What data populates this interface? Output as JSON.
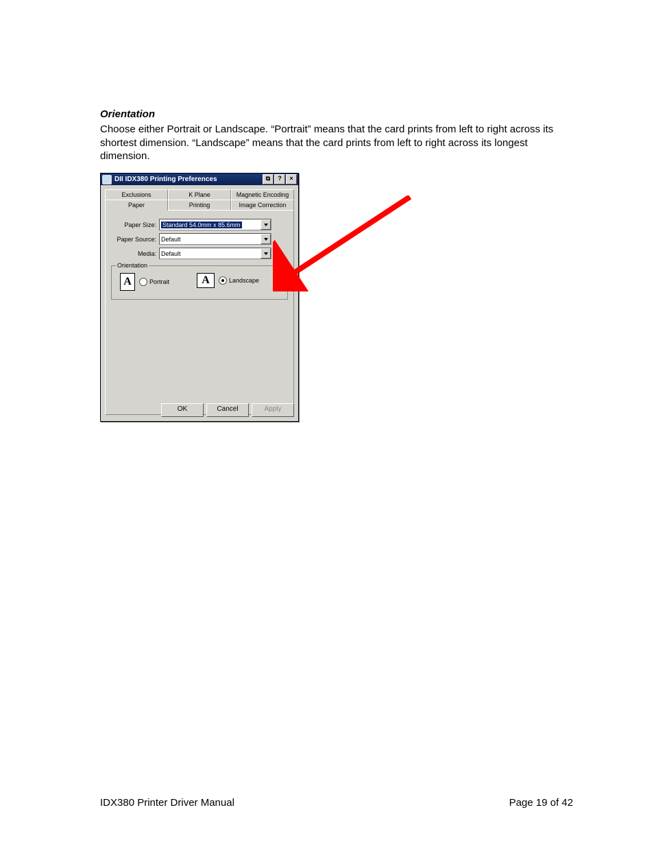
{
  "doc": {
    "section_title": "Orientation",
    "body_text": "Choose either Portrait or Landscape. “Portrait” means that the card prints from left to right across its shortest dimension. “Landscape” means that the card prints from left to right across its longest dimension.",
    "footer_left": "IDX380 Printer Driver Manual",
    "footer_right": "Page 19 of 42"
  },
  "dialog": {
    "title": "DII IDX380  Printing Preferences",
    "titlebar_btn_snap": "⧉",
    "titlebar_btn_help": "?",
    "titlebar_btn_close": "×",
    "tabs_row1": [
      "Exclusions",
      "K Plane",
      "Magnetic Encoding"
    ],
    "tabs_row2": [
      "Paper",
      "Printing",
      "Image Correction"
    ],
    "fields": {
      "paper_size": {
        "label": "Paper Size:",
        "value": "Standard 54.0mm x 85.6mm"
      },
      "paper_source": {
        "label": "Paper Source:",
        "value": "Default"
      },
      "media": {
        "label": "Media:",
        "value": "Default"
      }
    },
    "orientation": {
      "group_label": "Orientation",
      "portrait_glyph": "A",
      "portrait_label": "Portrait",
      "landscape_glyph": "A",
      "landscape_label": "Landscape",
      "selected": "landscape"
    },
    "buttons": {
      "ok": "OK",
      "cancel": "Cancel",
      "apply": "Apply"
    }
  }
}
